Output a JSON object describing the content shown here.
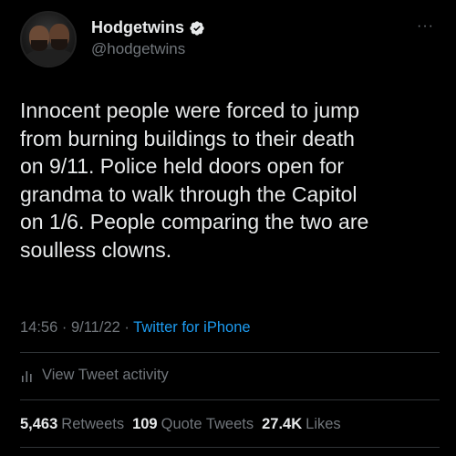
{
  "author": {
    "display_name": "Hodgetwins",
    "handle": "@hodgetwins",
    "verified": true
  },
  "more_icon": "more-options-icon",
  "tweet": {
    "text": "Innocent people were forced to jump\nfrom burning buildings to their death\non 9/11. Police held doors open for\ngrandma to walk through the Capitol\non 1/6. People comparing the two are\nsoulless clowns."
  },
  "meta": {
    "time": "14:56",
    "separator1": " · ",
    "date": "9/11/22",
    "separator2": " · ",
    "source": "Twitter for iPhone"
  },
  "activity": {
    "label": "View Tweet activity",
    "icon": "analytics-icon"
  },
  "stats": {
    "retweets_count": "5,463",
    "retweets_label": "Retweets",
    "quotes_count": "109",
    "quotes_label": "Quote Tweets",
    "likes_count": "27.4K",
    "likes_label": "Likes"
  },
  "colors": {
    "background": "#000000",
    "text": "#e7e9ea",
    "secondary": "#71767b",
    "accent": "#1d9bf0"
  }
}
